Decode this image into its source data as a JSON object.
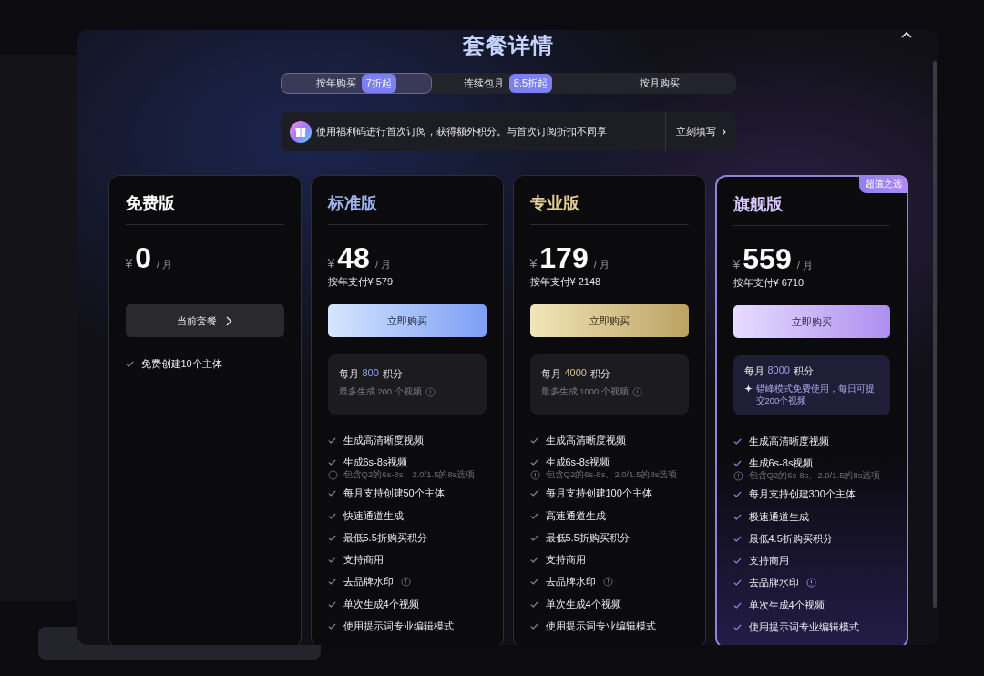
{
  "dialog": {
    "title": "套餐详情",
    "tabs": [
      {
        "label": "按年购买",
        "badge": "7折起",
        "selected": true
      },
      {
        "label": "连续包月",
        "badge": "8.5折起",
        "selected": false
      },
      {
        "label": "按月购买",
        "selected": false
      }
    ],
    "promo": {
      "text": "使用福利码进行首次订阅，获得额外积分。与首次订阅折扣不同享",
      "action": "立刻填写"
    },
    "plans": [
      {
        "kind": "free",
        "name": "免费版",
        "currency": "¥",
        "price": "0",
        "period": "/ 月",
        "button": {
          "kind": "current",
          "label": "当前套餐"
        },
        "features": [
          {
            "kind": "feature",
            "text": "免费创建10个主体",
            "info": false
          }
        ]
      },
      {
        "kind": "standard",
        "name": "标准版",
        "currency": "¥",
        "price": "48",
        "period": "/ 月",
        "yearly": "按年支付¥ 579",
        "button": {
          "kind": "buy",
          "label": "立即购买"
        },
        "credits": {
          "label": "每月",
          "amount": "800",
          "unit": "积分",
          "kind": "plain",
          "note": "最多生成 200 个视频"
        },
        "features": [
          {
            "kind": "feature",
            "text": "生成高清晰度视频",
            "info": false
          },
          {
            "kind": "feature",
            "text": "生成6s-8s视频",
            "info": false
          },
          {
            "kind": "note",
            "text": "包含Q2的6s-8s、2.0/1.5的8s选项",
            "info": true
          },
          {
            "kind": "feature",
            "text": "每月支持创建50个主体",
            "info": false
          },
          {
            "kind": "feature",
            "text": "快速通道生成",
            "info": false
          },
          {
            "kind": "feature",
            "text": "最低5.5折购买积分",
            "info": false
          },
          {
            "kind": "feature",
            "text": "支持商用",
            "info": false
          },
          {
            "kind": "feature",
            "text": "去品牌水印",
            "info": true
          },
          {
            "kind": "feature",
            "text": "单次生成4个视频",
            "info": false
          },
          {
            "kind": "feature",
            "text": "使用提示词专业编辑模式",
            "info": false
          }
        ]
      },
      {
        "kind": "pro",
        "name": "专业版",
        "currency": "¥",
        "price": "179",
        "period": "/ 月",
        "yearly": "按年支付¥ 2148",
        "button": {
          "kind": "buy",
          "label": "立即购买"
        },
        "credits": {
          "label": "每月",
          "amount": "4000",
          "unit": "积分",
          "kind": "plain",
          "note": "最多生成 1000 个视频"
        },
        "features": [
          {
            "kind": "feature",
            "text": "生成高清晰度视频",
            "info": false
          },
          {
            "kind": "feature",
            "text": "生成6s-8s视频",
            "info": false
          },
          {
            "kind": "note",
            "text": "包含Q2的6s-8s、2.0/1.5的8s选项",
            "info": true
          },
          {
            "kind": "feature",
            "text": "每月支持创建100个主体",
            "info": false
          },
          {
            "kind": "feature",
            "text": "高速通道生成",
            "info": false
          },
          {
            "kind": "feature",
            "text": "最低5.5折购买积分",
            "info": false
          },
          {
            "kind": "feature",
            "text": "支持商用",
            "info": false
          },
          {
            "kind": "feature",
            "text": "去品牌水印",
            "info": true
          },
          {
            "kind": "feature",
            "text": "单次生成4个视频",
            "info": false
          },
          {
            "kind": "feature",
            "text": "使用提示词专业编辑模式",
            "info": false
          }
        ]
      },
      {
        "kind": "flagship",
        "name": "旗舰版",
        "badge": "超值之选",
        "currency": "¥",
        "price": "559",
        "period": "/ 月",
        "yearly": "按年支付¥ 6710",
        "button": {
          "kind": "buy",
          "label": "立即购买"
        },
        "credits": {
          "label": "每月",
          "amount": "8000",
          "unit": "积分",
          "kind": "sparkle",
          "note": "错峰模式免费使用，每日可提交200个视频"
        },
        "features": [
          {
            "kind": "feature",
            "text": "生成高清晰度视频",
            "info": false
          },
          {
            "kind": "feature",
            "text": "生成6s-8s视频",
            "info": false
          },
          {
            "kind": "note",
            "text": "包含Q2的6s-8s、2.0/1.5的8s选项",
            "info": true
          },
          {
            "kind": "feature",
            "text": "每月支持创建300个主体",
            "info": false
          },
          {
            "kind": "feature",
            "text": "极速通道生成",
            "info": false
          },
          {
            "kind": "feature",
            "text": "最低4.5折购买积分",
            "info": false
          },
          {
            "kind": "feature",
            "text": "支持商用",
            "info": false
          },
          {
            "kind": "feature",
            "text": "去品牌水印",
            "info": true
          },
          {
            "kind": "feature",
            "text": "单次生成4个视频",
            "info": false
          },
          {
            "kind": "feature",
            "text": "使用提示词专业编辑模式",
            "info": false
          }
        ]
      }
    ]
  }
}
